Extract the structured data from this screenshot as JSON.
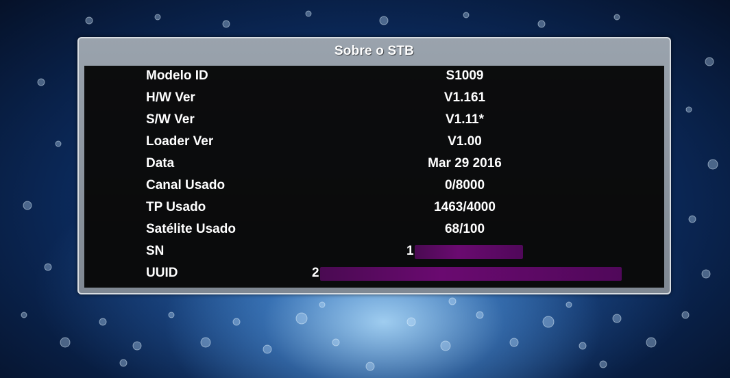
{
  "dialog": {
    "title": "Sobre o STB"
  },
  "info": [
    {
      "label": "Modelo ID",
      "value": "S1009"
    },
    {
      "label": "H/W Ver",
      "value": "V1.161"
    },
    {
      "label": "S/W Ver",
      "value": "V1.11*"
    },
    {
      "label": "Loader Ver",
      "value": "V1.00"
    },
    {
      "label": "Data",
      "value": "Mar 29 2016"
    },
    {
      "label": "Canal Usado",
      "value": "0/8000"
    },
    {
      "label": "TP Usado",
      "value": "1463/4000"
    },
    {
      "label": "Satélite Usado",
      "value": "68/100"
    },
    {
      "label": "SN",
      "value": "1"
    },
    {
      "label": "UUID",
      "value": "2"
    }
  ],
  "colors": {
    "dialog_frame": "#8e97a1",
    "panel": "#000000",
    "text": "#ffffff",
    "redaction": "#5a0a60"
  }
}
